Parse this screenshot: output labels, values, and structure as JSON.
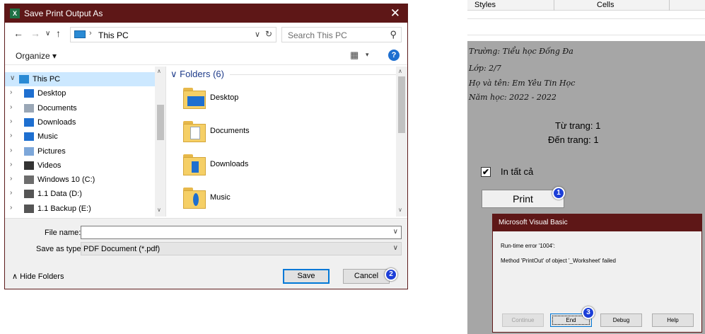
{
  "save_dialog": {
    "app_badge": "X",
    "title": "Save Print Output As",
    "close": "✕",
    "address": {
      "path": "This PC",
      "separator": "›",
      "dropdown": "∨",
      "refresh": "↻"
    },
    "search_placeholder": "Search This PC",
    "nav": {
      "back": "←",
      "forward": "→",
      "recent": "∨",
      "up": "↑"
    },
    "toolbar": {
      "organize": "Organize ▾",
      "view": "▦",
      "view_dd": "▾",
      "help": "?"
    },
    "tree": [
      {
        "label": "This PC",
        "chev": "∨",
        "selected": true,
        "icon": "pc-icon",
        "color": "#2a8ad4"
      },
      {
        "label": "Desktop",
        "chev": "›",
        "icon": "desktop-icon",
        "color": "#1e6fd0"
      },
      {
        "label": "Documents",
        "chev": "›",
        "icon": "documents-icon",
        "color": "#9aa7b6"
      },
      {
        "label": "Downloads",
        "chev": "›",
        "icon": "downloads-icon",
        "color": "#1e6fd0"
      },
      {
        "label": "Music",
        "chev": "›",
        "icon": "music-icon",
        "color": "#1e6fd0"
      },
      {
        "label": "Pictures",
        "chev": "›",
        "icon": "pictures-icon",
        "color": "#7da7d9"
      },
      {
        "label": "Videos",
        "chev": "›",
        "icon": "videos-icon",
        "color": "#333333"
      },
      {
        "label": "Windows 10 (C:)",
        "chev": "›",
        "icon": "drive-c-icon",
        "color": "#6d6d6d"
      },
      {
        "label": "1.1 Data (D:)",
        "chev": "›",
        "icon": "drive-d-icon",
        "color": "#555555"
      },
      {
        "label": "1.1 Backup (E:)",
        "chev": "›",
        "icon": "drive-e-icon",
        "color": "#555555"
      }
    ],
    "group_header": "∨  Folders (6)",
    "folders": [
      {
        "label": "Desktop",
        "icon": "desktop-folder-icon"
      },
      {
        "label": "Documents",
        "icon": "documents-folder-icon"
      },
      {
        "label": "Downloads",
        "icon": "downloads-folder-icon"
      },
      {
        "label": "Music",
        "icon": "music-folder-icon"
      }
    ],
    "file_name_label": "File name:",
    "file_name_value": "",
    "save_as_type_label": "Save as type:",
    "save_as_type_value": "PDF Document (*.pdf)",
    "hide_folders": "∧  Hide Folders",
    "save_button": "Save",
    "cancel_button": "Cancel",
    "step_badge": "2",
    "scroll_up": "∧",
    "scroll_down": "∨"
  },
  "excel": {
    "ribbon_groups": [
      "Styles",
      "Cells"
    ],
    "lines": [
      "Trường: Tiểu học Đống Đa",
      "Lớp:    2/7",
      "Họ và tên: Em Yêu Tin Học",
      "Năm học: 2022 - 2022"
    ],
    "from_page": "Từ trang: 1",
    "to_page": "Đến trang: 1",
    "checkbox_label": "In tất cả",
    "checkbox_checked": "✔",
    "print_button": "Print",
    "print_badge": "1"
  },
  "vb_dialog": {
    "title": "Microsoft Visual Basic",
    "error_line": "Run-time error '1004':",
    "message": "Method 'PrintOut' of object '_Worksheet' failed",
    "buttons": {
      "continue": "Continue",
      "end": "End",
      "debug": "Debug",
      "help": "Help"
    },
    "badge": "3"
  },
  "colors": {
    "titlebar": "#5e1717",
    "accent": "#0078d7",
    "badge": "#1d3fd8",
    "sheet": "#a6a6a6"
  }
}
